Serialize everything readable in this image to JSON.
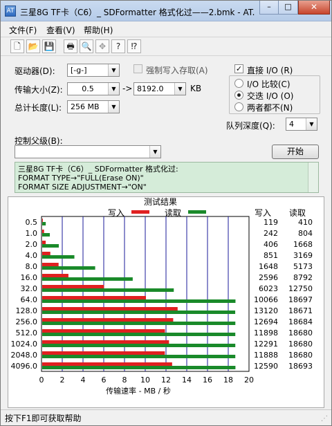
{
  "window": {
    "title": "三星8G TF卡（C6）_ SDFormatter 格式化过——2.bmk - AT...",
    "app_icon": "AT",
    "min_label": "–",
    "max_label": "□",
    "close_label": "✕"
  },
  "menu": [
    {
      "label": "文件(F)"
    },
    {
      "label": "查看(V)"
    },
    {
      "label": "帮助(H)"
    }
  ],
  "toolbar": [
    {
      "icon": "new-file-icon",
      "glyph": "🗋"
    },
    {
      "icon": "open-folder-icon",
      "glyph": "📂"
    },
    {
      "icon": "save-icon",
      "glyph": "💾"
    },
    {
      "icon": "print-icon",
      "glyph": "🖶"
    },
    {
      "icon": "print-preview-icon",
      "glyph": "🔍"
    },
    {
      "icon": "move-icon",
      "glyph": "✥"
    },
    {
      "icon": "help-icon",
      "glyph": "?"
    },
    {
      "icon": "context-help-icon",
      "glyph": "⁉"
    }
  ],
  "controls": {
    "drive_label": "驱动器(D):",
    "drive_value": "[-g-]",
    "force_write_label": "强制写入存取(A)",
    "direct_io_label": "直接 I/O (R)",
    "direct_io_checked": true,
    "transfer_size_label": "传输大小(Z):",
    "transfer_from": "0.5",
    "transfer_arrow": "->",
    "transfer_to": "8192.0",
    "transfer_unit": "KB",
    "total_length_label": "总计长度(L):",
    "total_length_value": "256 MB",
    "io_compare_label": "I/O 比较(C)",
    "io_swap_label": "交迭 I/O (O)",
    "neither_label": "两者都不(N)",
    "queue_depth_label": "队列深度(Q):",
    "queue_depth_value": "4",
    "control_label": "控制父级(B):",
    "control_value": "",
    "start_button": "开始"
  },
  "info_lines": [
    "三星8G TF卡（C6）_ SDFormatter 格式化过:",
    "FORMAT TYPE→\"FULL(Erase ON)\"",
    "FORMAT SIZE ADJUSTMENT→\"ON\""
  ],
  "status": {
    "text": "按下F1即可获取帮助"
  },
  "chart_data": {
    "type": "bar",
    "orientation": "horizontal",
    "title": "测试结果",
    "legend": [
      {
        "name": "写入",
        "color": "#e02020"
      },
      {
        "name": "读取",
        "color": "#1a8a2a"
      }
    ],
    "col_headers": [
      "写入",
      "读取"
    ],
    "categories": [
      "0.5",
      "1.0",
      "2.0",
      "4.0",
      "8.0",
      "16.0",
      "32.0",
      "64.0",
      "128.0",
      "256.0",
      "512.0",
      "1024.0",
      "2048.0",
      "4096.0"
    ],
    "series": [
      {
        "name": "写入",
        "color": "#e02020",
        "values": [
          0.119,
          0.242,
          0.406,
          0.851,
          1.648,
          2.596,
          6.023,
          10.066,
          13.12,
          12.694,
          11.898,
          12.291,
          11.888,
          12.59
        ]
      },
      {
        "name": "读取",
        "color": "#1a8a2a",
        "values": [
          0.41,
          0.804,
          1.668,
          3.169,
          5.173,
          8.792,
          12.75,
          18.697,
          18.671,
          18.684,
          18.68,
          18.68,
          18.68,
          18.693
        ]
      }
    ],
    "write_kb": [
      "119",
      "242",
      "406",
      "851",
      "1648",
      "2596",
      "6023",
      "10066",
      "13120",
      "12694",
      "11898",
      "12291",
      "11888",
      "12590"
    ],
    "read_kb": [
      "410",
      "804",
      "1668",
      "3169",
      "5173",
      "8792",
      "12750",
      "18697",
      "18671",
      "18684",
      "18680",
      "18680",
      "18680",
      "18693"
    ],
    "xticks": [
      "0",
      "2",
      "4",
      "6",
      "8",
      "10",
      "12",
      "14",
      "16",
      "18",
      "20"
    ],
    "xlim": [
      0,
      20
    ],
    "xlabel": "传输速率 - MB / 秒",
    "grid": true
  }
}
